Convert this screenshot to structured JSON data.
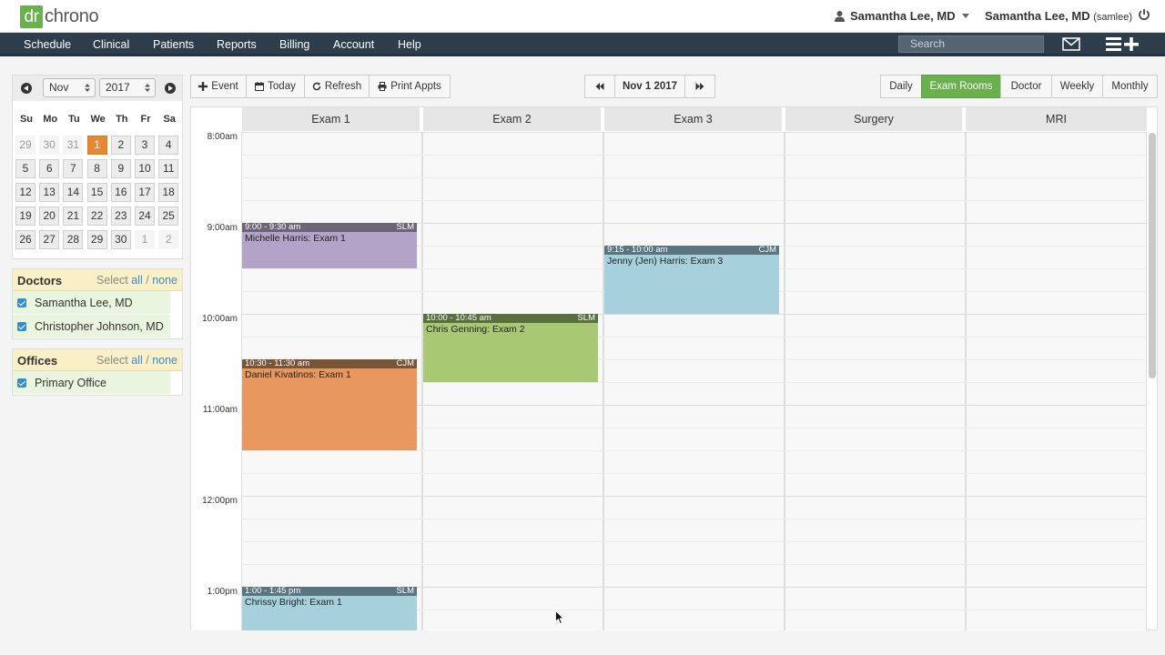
{
  "header": {
    "logo_dr": "dr",
    "logo_chrono": "chrono",
    "user_menu": "Samantha Lee, MD",
    "user_name": "Samantha Lee, MD",
    "user_id": "(samlee)"
  },
  "nav": {
    "items": [
      "Schedule",
      "Clinical",
      "Patients",
      "Reports",
      "Billing",
      "Account",
      "Help"
    ],
    "search_placeholder": "Search"
  },
  "mini_calendar": {
    "month": "Nov",
    "year": "2017",
    "dow": [
      "Su",
      "Mo",
      "Tu",
      "We",
      "Th",
      "Fr",
      "Sa"
    ],
    "weeks": [
      [
        "29",
        "30",
        "31",
        "1",
        "2",
        "3",
        "4"
      ],
      [
        "5",
        "6",
        "7",
        "8",
        "9",
        "10",
        "11"
      ],
      [
        "12",
        "13",
        "14",
        "15",
        "16",
        "17",
        "18"
      ],
      [
        "19",
        "20",
        "21",
        "22",
        "23",
        "24",
        "25"
      ],
      [
        "26",
        "27",
        "28",
        "29",
        "30",
        "1",
        "2"
      ]
    ],
    "selected": "1"
  },
  "doctors": {
    "title": "Doctors",
    "select_prefix": "Select",
    "select_all": "all",
    "separator": "/",
    "select_none": "none",
    "items": [
      "Samantha Lee, MD",
      "Christopher Johnson, MD"
    ]
  },
  "offices": {
    "title": "Offices",
    "select_prefix": "Select",
    "select_all": "all",
    "separator": "/",
    "select_none": "none",
    "items": [
      "Primary Office"
    ]
  },
  "toolbar": {
    "event": "Event",
    "today": "Today",
    "refresh": "Refresh",
    "print": "Print Appts",
    "date": "Nov 1 2017",
    "views": [
      "Daily",
      "Exam Rooms",
      "Doctor",
      "Weekly",
      "Monthly"
    ],
    "active_view": "Exam Rooms"
  },
  "calendar": {
    "rooms": [
      "Exam 1",
      "Exam 2",
      "Exam 3",
      "Surgery",
      "MRI"
    ],
    "times": [
      "8:00am",
      "9:00am",
      "10:00am",
      "11:00am",
      "12:00pm",
      "1:00pm"
    ],
    "appointments": [
      {
        "room": 0,
        "time": "9:00 - 9:30 am",
        "doctor": "SLM",
        "title": "Michelle Harris: Exam 1",
        "start": 9.0,
        "end": 9.5,
        "header_color": "#6d6478",
        "color": "#b3a3c9"
      },
      {
        "room": 2,
        "time": "9:15 - 10:00 am",
        "doctor": "CJM",
        "title": "Jenny (Jen) Harris: Exam 3",
        "start": 9.25,
        "end": 10.0,
        "header_color": "#5a7580",
        "color": "#a6d1dc"
      },
      {
        "room": 1,
        "time": "10:00 - 10:45 am",
        "doctor": "SLM",
        "title": "Chris Genning: Exam 2",
        "start": 10.0,
        "end": 10.75,
        "header_color": "#5a6e3e",
        "color": "#a8c874"
      },
      {
        "room": 0,
        "time": "10:30 - 11:30 am",
        "doctor": "CJM",
        "title": "Daniel Kivatinos: Exam 1",
        "start": 10.5,
        "end": 11.5,
        "header_color": "#7a5535",
        "color": "#e8985e"
      },
      {
        "room": 0,
        "time": "1:00 - 1:45 pm",
        "doctor": "SLM",
        "title": "Chrissy Bright: Exam 1",
        "start": 13.0,
        "end": 13.75,
        "header_color": "#5a7580",
        "color": "#a6d1dc"
      }
    ]
  }
}
